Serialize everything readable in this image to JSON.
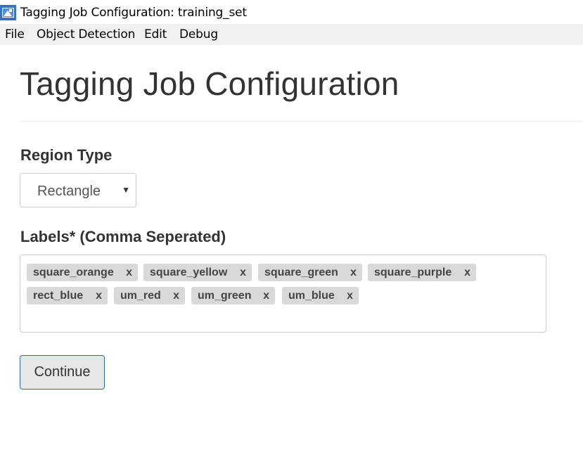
{
  "window": {
    "title": "Tagging Job Configuration: training_set",
    "icon": "app-icon"
  },
  "menubar": {
    "items": [
      {
        "label": "File"
      },
      {
        "label": "Object Detection"
      },
      {
        "label": "Edit"
      },
      {
        "label": "Debug"
      }
    ]
  },
  "page": {
    "title": "Tagging Job Configuration"
  },
  "region_type": {
    "label": "Region Type",
    "selected": "Rectangle",
    "arrow": "▼"
  },
  "labels": {
    "label": "Labels* (Comma Seperated)",
    "remove_glyph": "x",
    "tags": [
      "square_orange",
      "square_yellow",
      "square_green",
      "square_purple",
      "rect_blue",
      "um_red",
      "um_green",
      "um_blue"
    ]
  },
  "actions": {
    "continue_label": "Continue"
  },
  "colors": {
    "menubar_bg": "#f0f0f0",
    "tag_bg": "#d9d9d9",
    "button_border": "#2e6da4",
    "text": "#333333"
  }
}
